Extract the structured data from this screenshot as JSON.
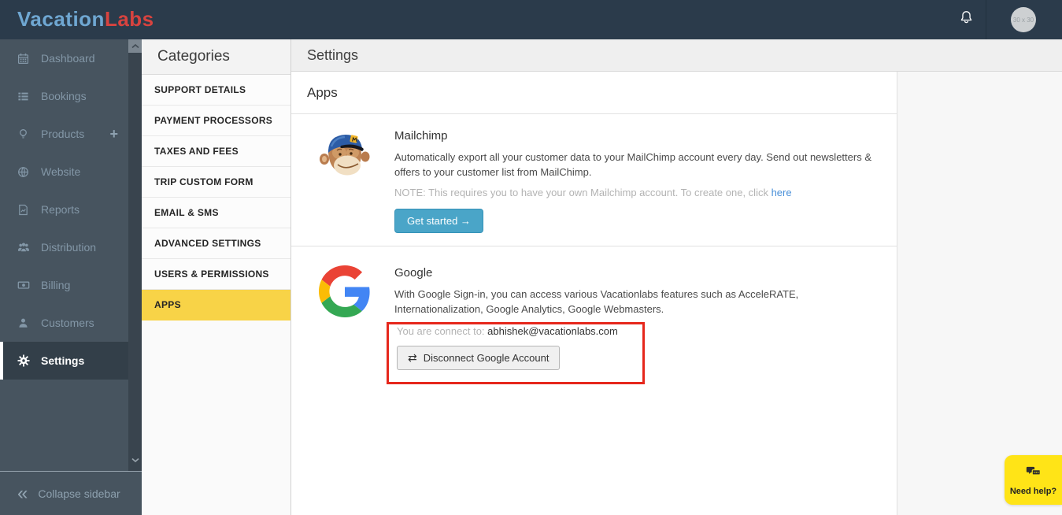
{
  "topbar": {
    "logo_vacation": "Vacation",
    "logo_labs": "Labs",
    "avatar_placeholder": "30 x 30"
  },
  "sidebar": {
    "items": [
      {
        "label": "Dashboard",
        "icon": "calendar"
      },
      {
        "label": "Bookings",
        "icon": "list"
      },
      {
        "label": "Products",
        "icon": "lightbulb"
      },
      {
        "label": "Website",
        "icon": "globe"
      },
      {
        "label": "Reports",
        "icon": "report-document"
      },
      {
        "label": "Distribution",
        "icon": "user-group"
      },
      {
        "label": "Billing",
        "icon": "banknote"
      },
      {
        "label": "Customers",
        "icon": "person"
      },
      {
        "label": "Settings",
        "icon": "gear",
        "active": true
      }
    ],
    "products_add": "+",
    "collapse_icon": "«",
    "collapse_label": "Collapse sidebar"
  },
  "categories": {
    "title": "Categories",
    "items": [
      "SUPPORT DETAILS",
      "PAYMENT PROCESSORS",
      "TAXES AND FEES",
      "TRIP CUSTOM FORM",
      "EMAIL & SMS",
      "ADVANCED SETTINGS",
      "USERS & PERMISSIONS",
      "APPS"
    ],
    "active_item": "APPS"
  },
  "main": {
    "page_title": "Settings",
    "section_title": "Apps",
    "mailchimp": {
      "name": "Mailchimp",
      "description": "Automatically export all your customer data to your MailChimp account every day. Send out newsletters & offers to your customer list from MailChimp.",
      "note_text": "NOTE: This requires you to have your own Mailchimp account. To create one, click ",
      "note_link": "here",
      "cta_label": "Get started →"
    },
    "google": {
      "name": "Google",
      "description": "With Google Sign-in, you can access various Vacationlabs features such as AcceleRATE, Internationalization, Google Analytics, Google Webmasters.",
      "connected_label": "You are connect to: ",
      "connected_email": "abhishek@vacationlabs.com",
      "disconnect_icon": "⇄",
      "disconnect_label": "Disconnect Google Account"
    }
  },
  "help": {
    "label": "Need help?"
  },
  "colors": {
    "topbar_bg": "#2b3b4b",
    "sidebar_bg": "#47545f",
    "sidebar_active_bg": "#333f49",
    "category_active_yellow": "#f8d347",
    "cta_blue": "#4aa5c8",
    "annotation_red": "#e6271c",
    "logo_blue": "#6fa7d2",
    "logo_red": "#d8433f",
    "need_help_yellow": "#ffe417",
    "link_blue": "#4a90d9"
  }
}
